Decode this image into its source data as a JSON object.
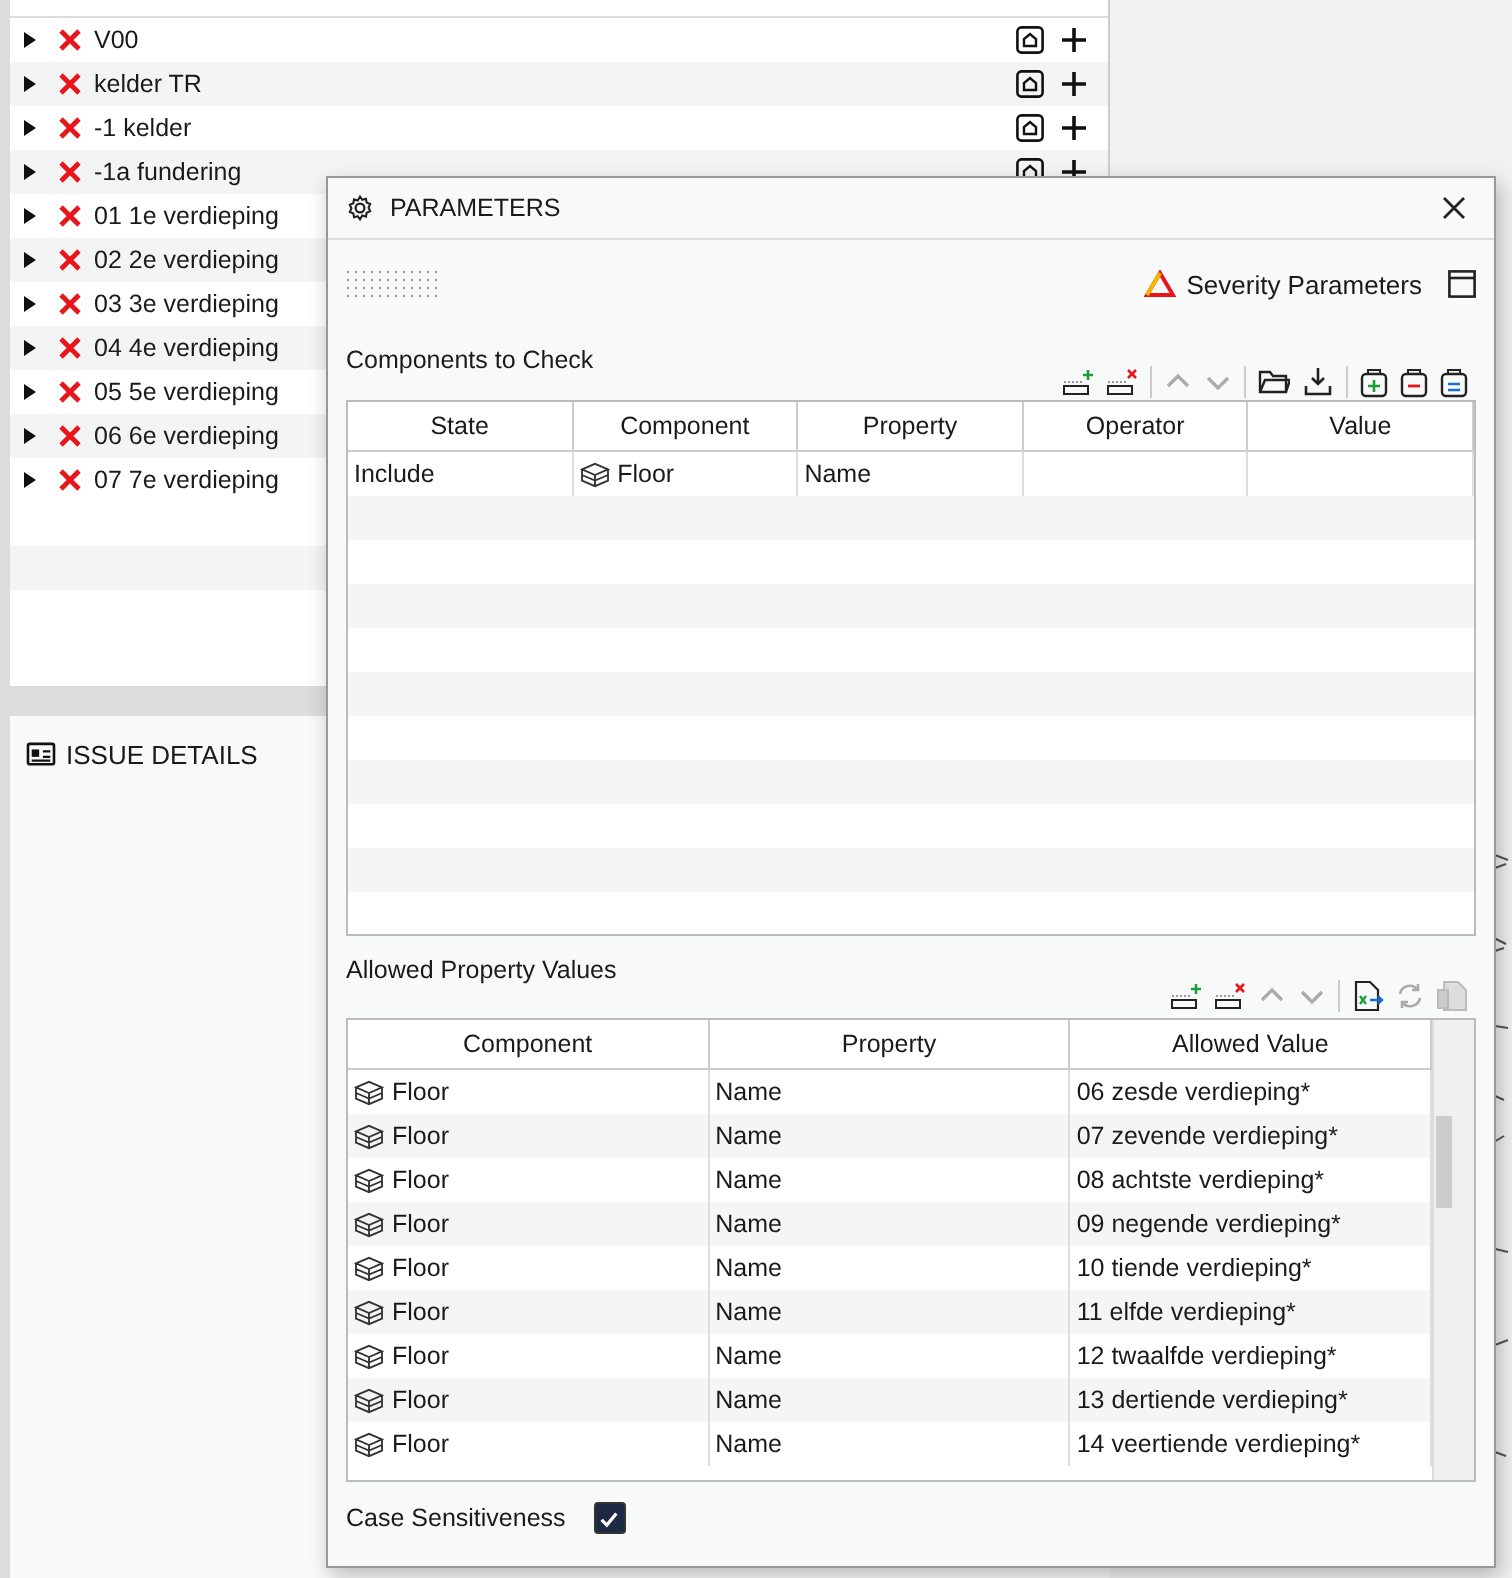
{
  "results": {
    "rows": [
      {
        "label": "V00",
        "expanded": false
      },
      {
        "label": "kelder TR",
        "expanded": false
      },
      {
        "label": "-1 kelder",
        "expanded": false
      },
      {
        "label": "-1a fundering",
        "expanded": false
      },
      {
        "label": "01 1e verdieping",
        "expanded": false
      },
      {
        "label": "02 2e verdieping",
        "expanded": false
      },
      {
        "label": "03 3e verdieping",
        "expanded": false
      },
      {
        "label": "04 4e verdieping",
        "expanded": false
      },
      {
        "label": "05 5e verdieping",
        "expanded": false
      },
      {
        "label": "06 6e verdieping",
        "expanded": false
      },
      {
        "label": "07 7e verdieping",
        "expanded": false
      }
    ]
  },
  "issue_details": {
    "title": "ISSUE DETAILS"
  },
  "dialog": {
    "title": "PARAMETERS",
    "severity_label": "Severity Parameters",
    "components": {
      "title": "Components to Check",
      "columns": [
        "State",
        "Component",
        "Property",
        "Operator",
        "Value"
      ],
      "rows": [
        {
          "state": "Include",
          "component": "Floor",
          "property": "Name",
          "operator": "",
          "value": ""
        }
      ]
    },
    "allowed": {
      "title": "Allowed Property Values",
      "columns": [
        "Component",
        "Property",
        "Allowed Value"
      ],
      "rows": [
        {
          "component": "Floor",
          "property": "Name",
          "value": "06 zesde verdieping*"
        },
        {
          "component": "Floor",
          "property": "Name",
          "value": "07 zevende verdieping*"
        },
        {
          "component": "Floor",
          "property": "Name",
          "value": "08 achtste verdieping*"
        },
        {
          "component": "Floor",
          "property": "Name",
          "value": "09 negende verdieping*"
        },
        {
          "component": "Floor",
          "property": "Name",
          "value": "10 tiende verdieping*"
        },
        {
          "component": "Floor",
          "property": "Name",
          "value": "11 elfde verdieping*"
        },
        {
          "component": "Floor",
          "property": "Name",
          "value": "12 twaalfde verdieping*"
        },
        {
          "component": "Floor",
          "property": "Name",
          "value": "13 dertiende verdieping*"
        },
        {
          "component": "Floor",
          "property": "Name",
          "value": "14 veertiende verdieping*"
        }
      ]
    },
    "case_sensitive": {
      "label": "Case Sensitiveness",
      "checked": true
    }
  }
}
